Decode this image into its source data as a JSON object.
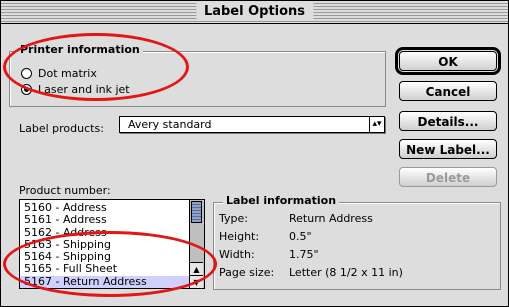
{
  "window": {
    "title": "Label Options"
  },
  "printer_info": {
    "title": "Printer information",
    "options": [
      {
        "label": "Dot matrix",
        "selected": false
      },
      {
        "label": "Laser and ink jet",
        "selected": true
      }
    ]
  },
  "label_products": {
    "label": "Label products:",
    "value": "Avery standard"
  },
  "buttons": {
    "ok": "OK",
    "cancel": "Cancel",
    "details": "Details...",
    "new_label": "New Label...",
    "delete": "Delete"
  },
  "product_number": {
    "label": "Product number:",
    "items": [
      "5160 - Address",
      "5161 - Address",
      "5162 - Address",
      "5163 - Shipping",
      "5164 - Shipping",
      "5165 - Full Sheet",
      "5167 - Return Address"
    ],
    "selected_index": 6
  },
  "label_info": {
    "title": "Label information",
    "type_label": "Type:",
    "type_value": "Return Address",
    "height_label": "Height:",
    "height_value": "0.5\"",
    "width_label": "Width:",
    "width_value": "1.75\"",
    "page_size_label": "Page size:",
    "page_size_value": "Letter (8 1/2 x 11 in)"
  },
  "colors": {
    "highlight_oval": "#e21616",
    "selection": "#d0d0ff"
  }
}
